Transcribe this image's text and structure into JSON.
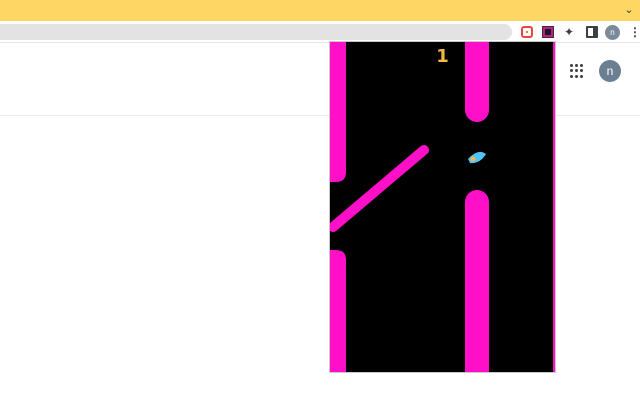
{
  "browser": {
    "bar_color": "#fdd663",
    "chevron_icon": "chevron-down-icon",
    "profile_initial": "n",
    "extensions": [
      "screen-recorder-icon",
      "game-extension-icon",
      "puzzle-icon",
      "side-panel-icon"
    ]
  },
  "page": {
    "apps_icon": "apps-grid-icon",
    "avatar_initial": "n",
    "avatar_color": "#6b7f92"
  },
  "game": {
    "score": "1",
    "background_color": "#000000",
    "wall_color": "#ff10c8",
    "score_color": "#f5b841",
    "player_colors": [
      "#4fc3f7",
      "#f5b841"
    ]
  }
}
